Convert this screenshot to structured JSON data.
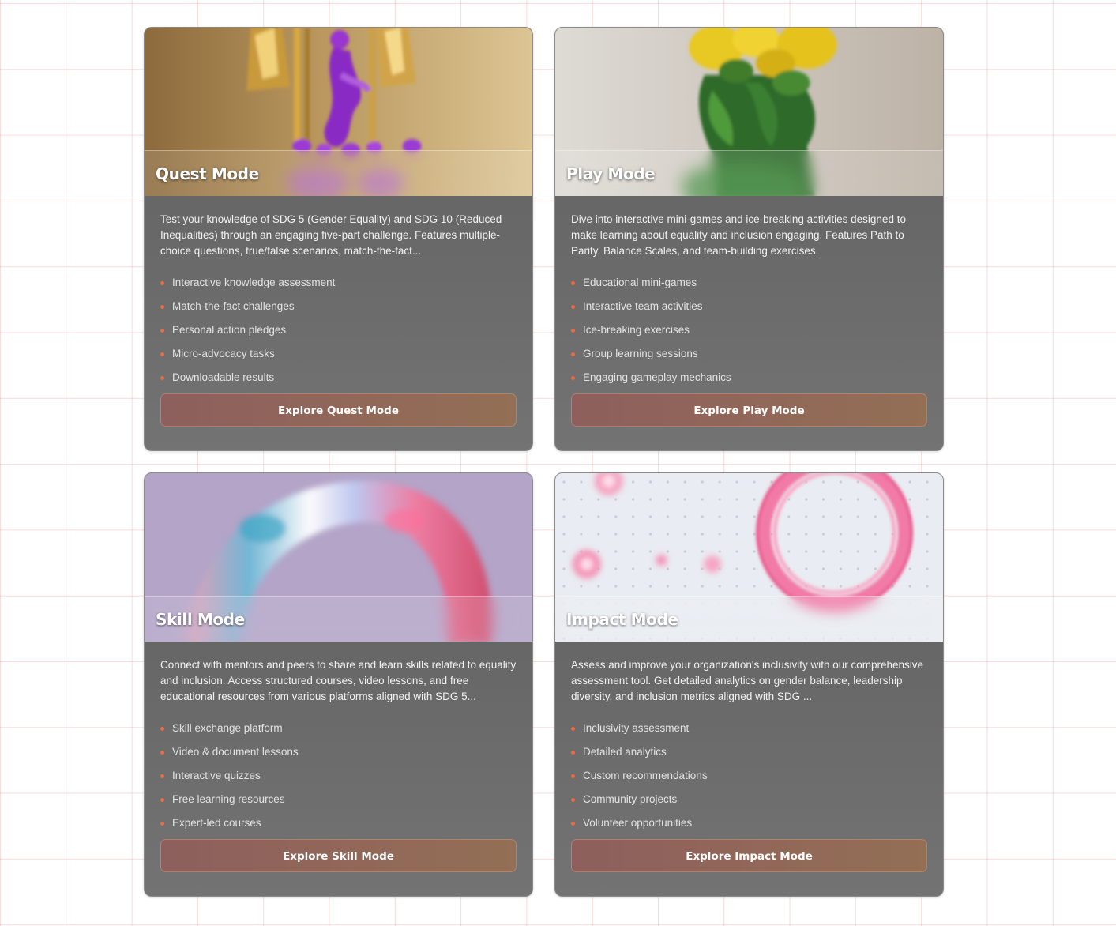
{
  "cards": [
    {
      "title": "Quest Mode",
      "image": "gold-purple-figurine-image",
      "description": "Test your knowledge of SDG 5 (Gender Equality) and SDG 10 (Reduced Inequalities) through an engaging five-part challenge. Features multiple-choice questions, true/false scenarios, match-the-fact...",
      "features": [
        "Interactive knowledge assessment",
        "Match-the-fact challenges",
        "Personal action pledges",
        "Micro-advocacy tasks",
        "Downloadable results"
      ],
      "button": "Explore Quest Mode"
    },
    {
      "title": "Play Mode",
      "image": "flower-head-sculpture-image",
      "description": "Dive into interactive mini-games and ice-breaking activities designed to make learning about equality and inclusion engaging. Features Path to Parity, Balance Scales, and team-building exercises.",
      "features": [
        "Educational mini-games",
        "Interactive team activities",
        "Ice-breaking exercises",
        "Group learning sessions",
        "Engaging gameplay mechanics"
      ],
      "button": "Explore Play Mode"
    },
    {
      "title": "Skill Mode",
      "image": "iridescent-glass-ring-image",
      "description": "Connect with mentors and peers to share and learn skills related to equality and inclusion. Access structured courses, video lessons, and free educational resources from various platforms aligned with SDG 5...",
      "features": [
        "Skill exchange platform",
        "Video & document lessons",
        "Interactive quizzes",
        "Free learning resources",
        "Expert-led courses"
      ],
      "button": "Explore Skill Mode"
    },
    {
      "title": "Impact Mode",
      "image": "pink-rings-spheres-image",
      "description": "Assess and improve your organization's inclusivity with our comprehensive assessment tool. Get detailed analytics on gender balance, leadership diversity, and inclusion metrics aligned with SDG ...",
      "features": [
        "Inclusivity assessment",
        "Detailed analytics",
        "Custom recommendations",
        "Community projects",
        "Volunteer opportunities"
      ],
      "button": "Explore Impact Mode"
    }
  ],
  "colors": {
    "accent_bullet": "#f06a3e",
    "button_start": "#8e5f5d",
    "button_end": "#936f55",
    "card_background": "#666666"
  }
}
